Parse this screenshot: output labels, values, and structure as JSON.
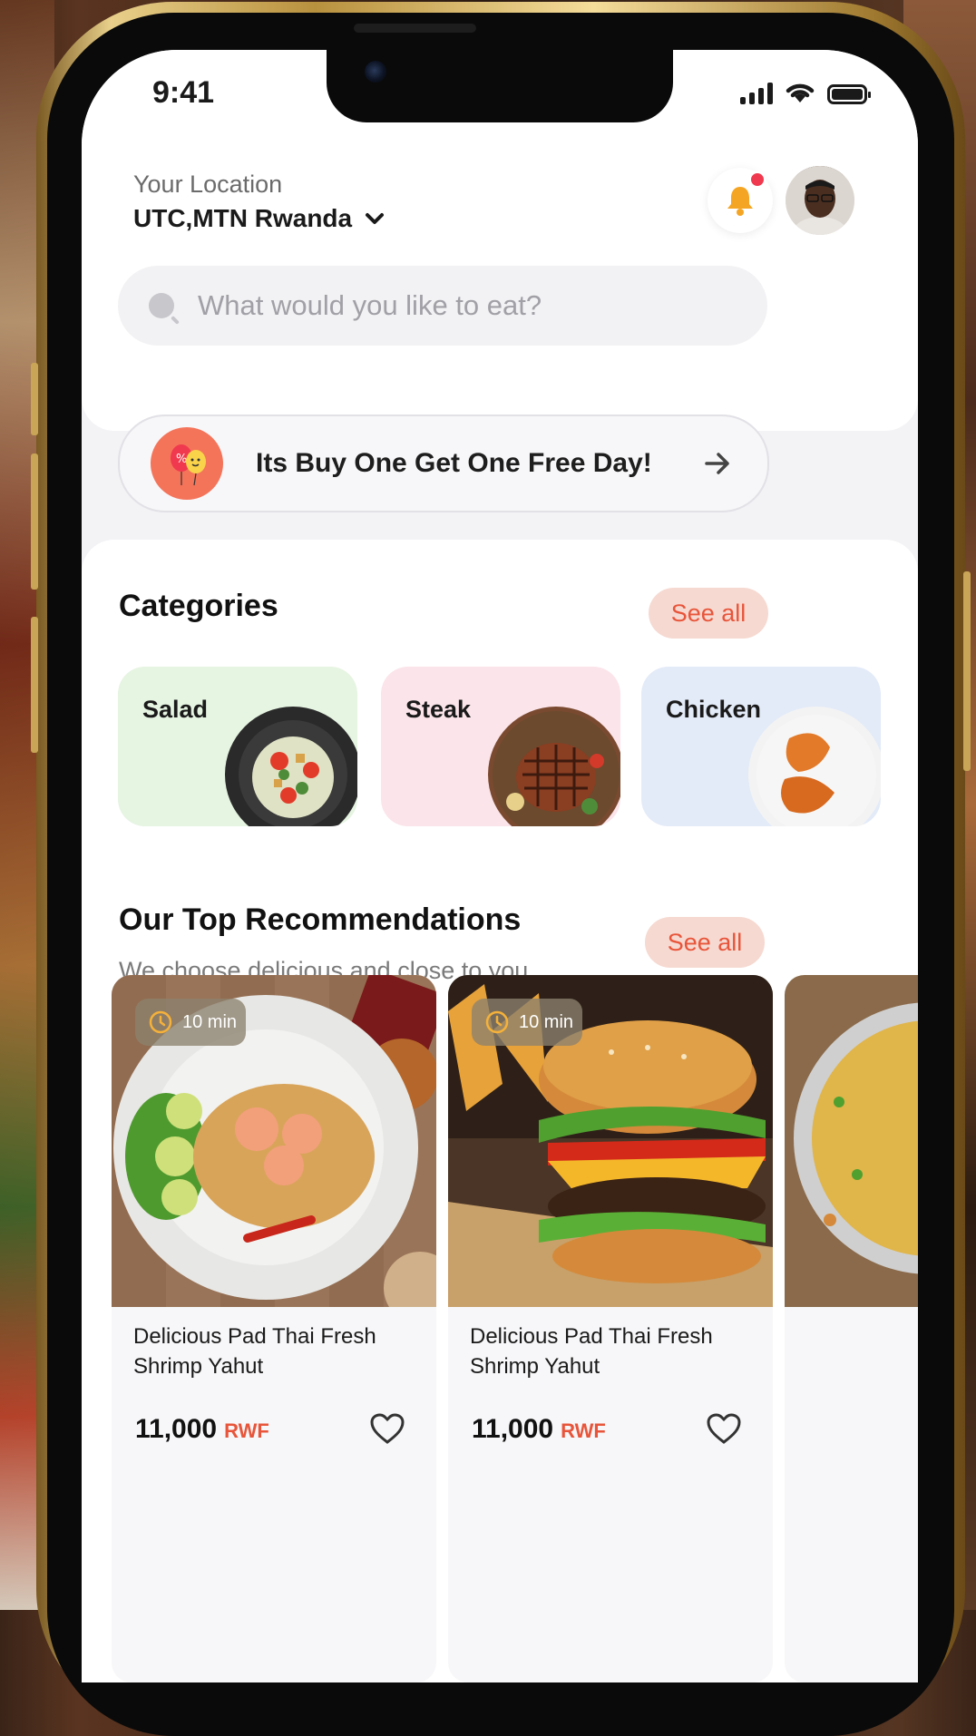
{
  "status_bar": {
    "time": "9:41"
  },
  "header": {
    "location_label": "Your Location",
    "location_value": "UTC,MTN Rwanda"
  },
  "search": {
    "placeholder": "What would you like to eat?"
  },
  "promo": {
    "text": "Its Buy One Get One Free Day!"
  },
  "categories": {
    "title": "Categories",
    "see_all_label": "See all",
    "items": [
      {
        "label": "Salad",
        "bg": "#e6f4e2"
      },
      {
        "label": "Steak",
        "bg": "#fbe4ea"
      },
      {
        "label": "Chicken",
        "bg": "#e3ebf8"
      }
    ]
  },
  "recommendations": {
    "title": "Our Top Recommendations",
    "subtitle": "We choose delicious and close to you.",
    "see_all_label": "See all",
    "items": [
      {
        "time": "10 min",
        "name": "Delicious Pad Thai Fresh Shrimp Yahut",
        "price": "11,000",
        "currency": "RWF"
      },
      {
        "time": "10 min",
        "name": "Delicious Pad Thai Fresh Shrimp Yahut",
        "price": "11,000",
        "currency": "RWF"
      }
    ]
  },
  "colors": {
    "accent": "#e8553a",
    "accent_bg": "#f6d9d1",
    "bell": "#f5a524",
    "notification": "#f0394e"
  },
  "icons": [
    "signal-icon",
    "wifi-icon",
    "battery-icon",
    "chevron-down-icon",
    "bell-icon",
    "search-icon",
    "balloon-icon",
    "arrow-right-icon",
    "clock-icon",
    "heart-icon"
  ]
}
